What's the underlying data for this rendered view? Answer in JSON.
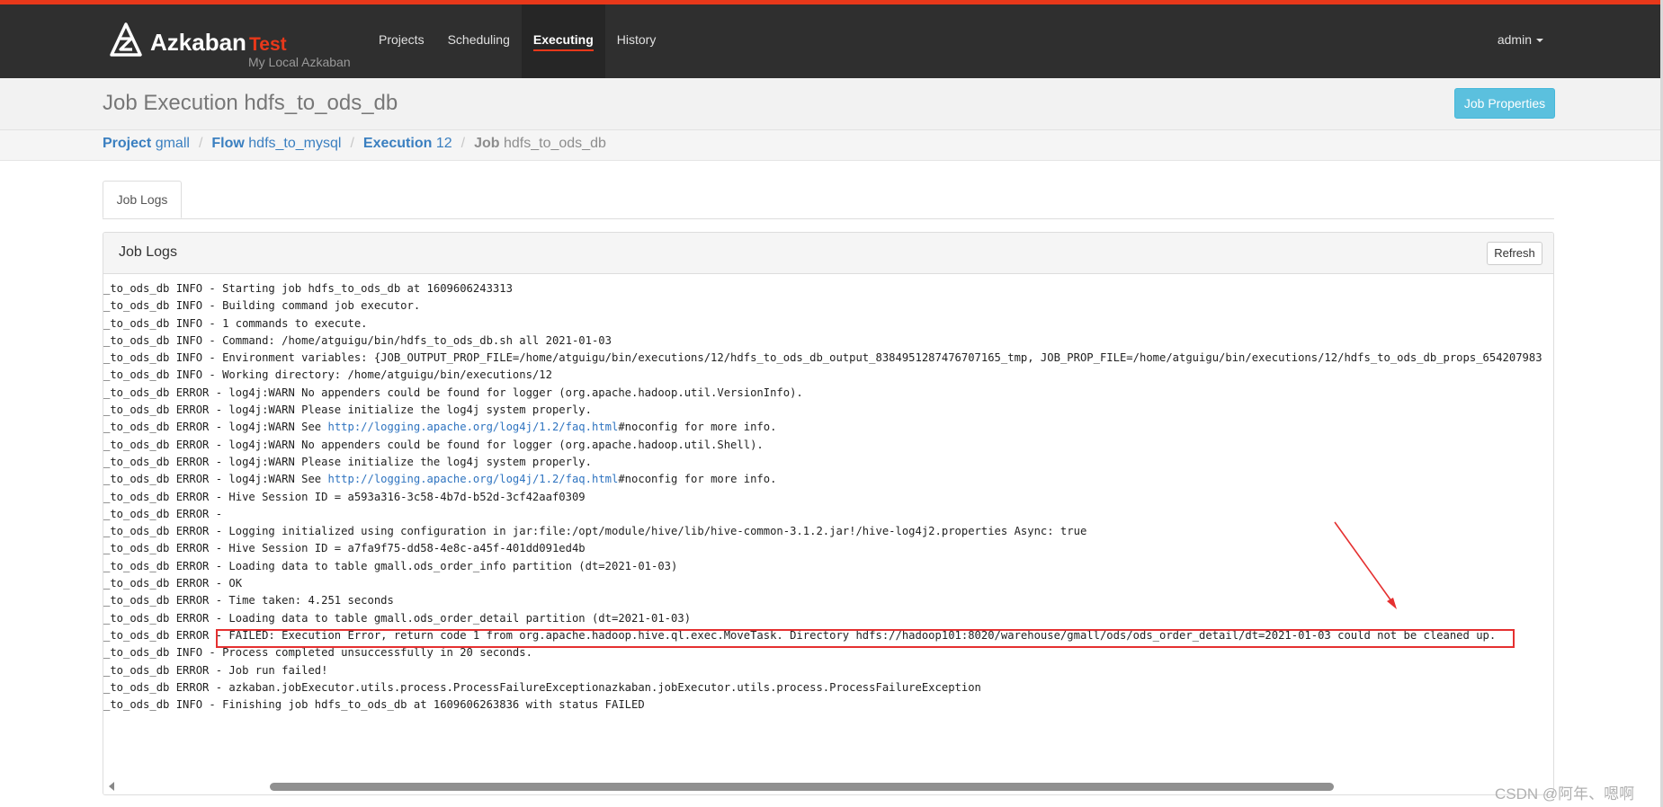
{
  "nav": {
    "brand": "Azkaban",
    "env": "Test",
    "subtitle": "My Local Azkaban",
    "items": [
      "Projects",
      "Scheduling",
      "Executing",
      "History"
    ],
    "active": "Executing",
    "user": "admin"
  },
  "header": {
    "title": "Job Execution hdfs_to_ods_db",
    "job_properties_label": "Job Properties"
  },
  "breadcrumb": [
    {
      "key": "Project",
      "value": "gmall"
    },
    {
      "key": "Flow",
      "value": "hdfs_to_mysql"
    },
    {
      "key": "Execution",
      "value": "12"
    },
    {
      "key": "Job",
      "value": "hdfs_to_ods_db"
    }
  ],
  "tabs": [
    "Job Logs"
  ],
  "panel": {
    "title": "Job Logs",
    "refresh_label": "Refresh"
  },
  "log_lines": [
    "_to_ods_db INFO - Starting job hdfs_to_ods_db at 1609606243313",
    "_to_ods_db INFO - Building command job executor.",
    "_to_ods_db INFO - 1 commands to execute.",
    "_to_ods_db INFO - Command: /home/atguigu/bin/hdfs_to_ods_db.sh all 2021-01-03",
    "_to_ods_db INFO - Environment variables: {JOB_OUTPUT_PROP_FILE=/home/atguigu/bin/executions/12/hdfs_to_ods_db_output_8384951287476707165_tmp, JOB_PROP_FILE=/home/atguigu/bin/executions/12/hdfs_to_ods_db_props_654207983",
    "_to_ods_db INFO - Working directory: /home/atguigu/bin/executions/12",
    "_to_ods_db ERROR - log4j:WARN No appenders could be found for logger (org.apache.hadoop.util.VersionInfo).",
    "_to_ods_db ERROR - log4j:WARN Please initialize the log4j system properly.",
    "_to_ods_db ERROR - log4j:WARN See |http://logging.apache.org/log4j/1.2/faq.html|#noconfig for more info.",
    "_to_ods_db ERROR - log4j:WARN No appenders could be found for logger (org.apache.hadoop.util.Shell).",
    "_to_ods_db ERROR - log4j:WARN Please initialize the log4j system properly.",
    "_to_ods_db ERROR - log4j:WARN See |http://logging.apache.org/log4j/1.2/faq.html|#noconfig for more info.",
    "_to_ods_db ERROR - Hive Session ID = a593a316-3c58-4b7d-b52d-3cf42aaf0309",
    "_to_ods_db ERROR - ",
    "_to_ods_db ERROR - Logging initialized using configuration in jar:file:/opt/module/hive/lib/hive-common-3.1.2.jar!/hive-log4j2.properties Async: true",
    "_to_ods_db ERROR - Hive Session ID = a7fa9f75-dd58-4e8c-a45f-401dd091ed4b",
    "_to_ods_db ERROR - Loading data to table gmall.ods_order_info partition (dt=2021-01-03)",
    "_to_ods_db ERROR - OK",
    "_to_ods_db ERROR - Time taken: 4.251 seconds",
    "_to_ods_db ERROR - Loading data to table gmall.ods_order_detail partition (dt=2021-01-03)",
    "_to_ods_db ERROR - FAILED: Execution Error, return code 1 from org.apache.hadoop.hive.ql.exec.MoveTask. Directory hdfs://hadoop101:8020/warehouse/gmall/ods/ods_order_detail/dt=2021-01-03 could not be cleaned up.",
    "_to_ods_db INFO - Process completed unsuccessfully in 20 seconds.",
    "_to_ods_db ERROR - Job run failed!",
    "_to_ods_db ERROR - azkaban.jobExecutor.utils.process.ProcessFailureExceptionazkaban.jobExecutor.utils.process.ProcessFailureException",
    "_to_ods_db INFO - Finishing job hdfs_to_ods_db at 1609606263836 with status FAILED"
  ],
  "watermark": "CSDN @阿年、嗯啊",
  "colors": {
    "navbar": "#2f2f2f",
    "accent": "#e8381a",
    "link": "#3a7fc0",
    "info_button": "#5bc0de",
    "annotation": "#e53030"
  }
}
